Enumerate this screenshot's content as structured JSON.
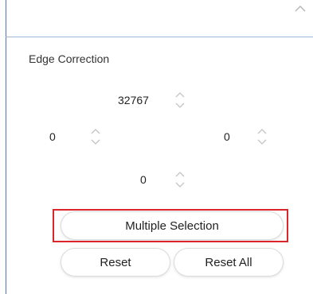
{
  "panel": {
    "title": "Edge Correction"
  },
  "edge_correction": {
    "top": "32767",
    "left": "0",
    "right": "0",
    "bottom": "0"
  },
  "buttons": {
    "multiple_selection": "Multiple Selection",
    "reset": "Reset",
    "reset_all": "Reset All"
  },
  "icons": {
    "collapse": "chevron-up-icon",
    "spinner": "spinner-arrows-icon"
  },
  "colors": {
    "highlight": "#d9262b",
    "panel_border": "#4a78b5"
  }
}
